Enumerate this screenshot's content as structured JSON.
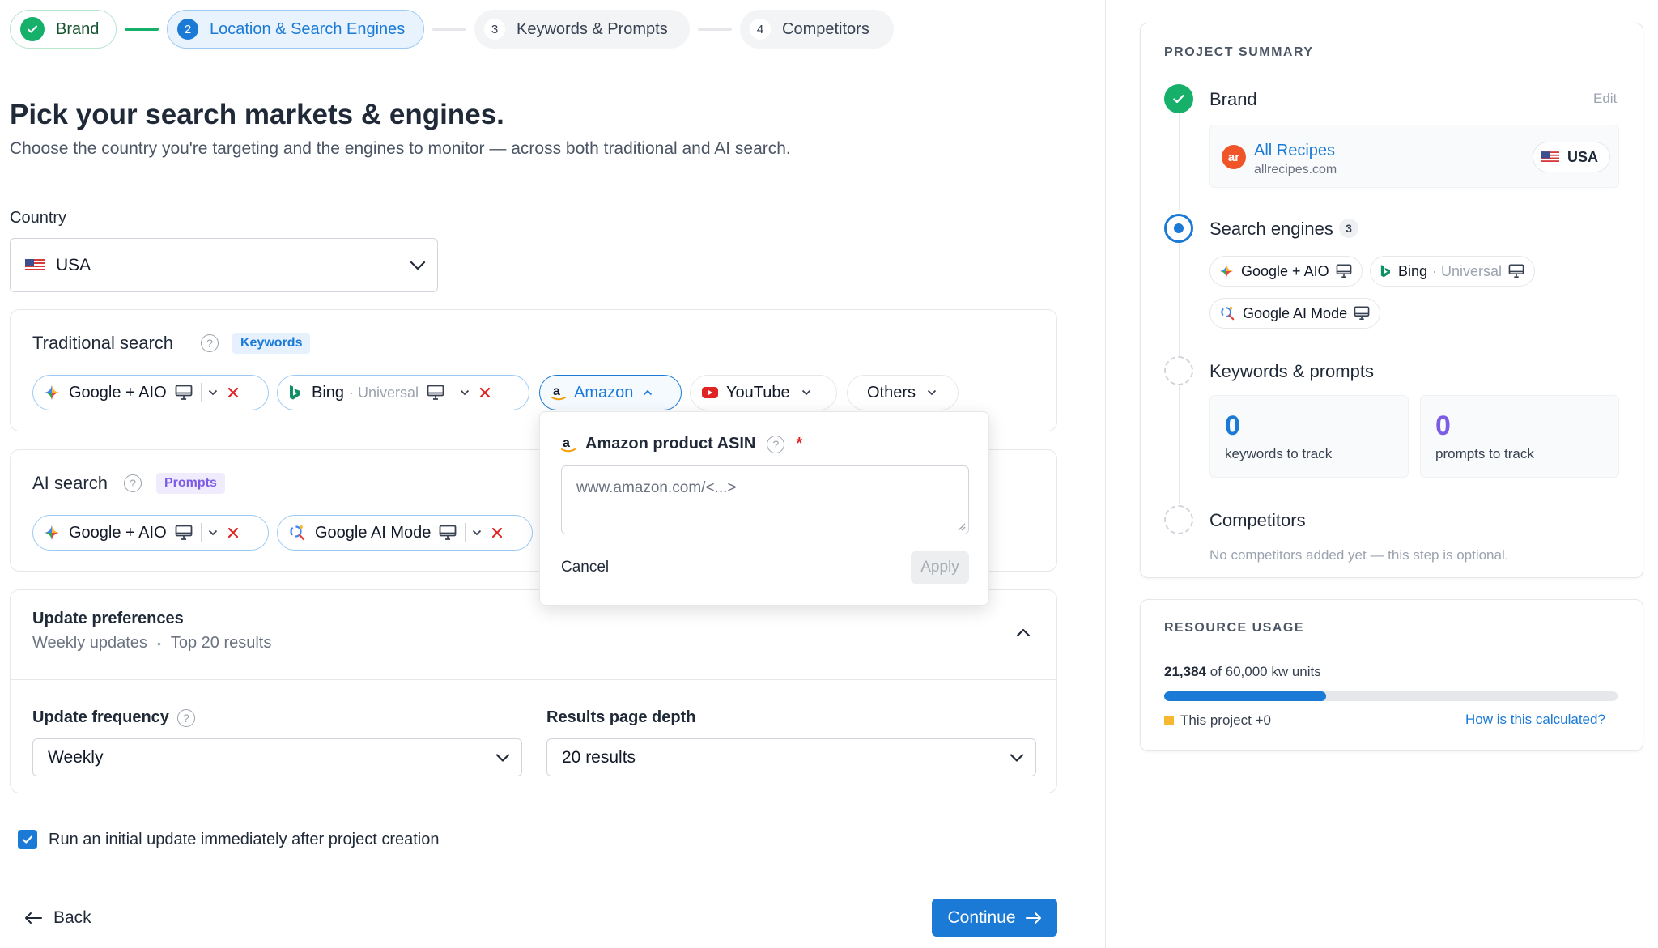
{
  "stepper": [
    {
      "num": "",
      "label": "Brand",
      "state": "done"
    },
    {
      "num": "2",
      "label": "Location & Search Engines",
      "state": "active"
    },
    {
      "num": "3",
      "label": "Keywords & Prompts",
      "state": "todo"
    },
    {
      "num": "4",
      "label": "Competitors",
      "state": "todo"
    }
  ],
  "page": {
    "title": "Pick your search markets & engines.",
    "subtitle": "Choose the country you're targeting and the engines to monitor — across both traditional and AI search."
  },
  "country": {
    "label": "Country",
    "value": "USA"
  },
  "traditional": {
    "title": "Traditional search",
    "tag": "Keywords",
    "chips": [
      {
        "label": "Google + AIO",
        "sub": ""
      },
      {
        "label": "Bing",
        "sub": "· Universal"
      },
      {
        "label": "Amazon"
      },
      {
        "label": "YouTube"
      },
      {
        "label": "Others"
      }
    ]
  },
  "ai": {
    "title": "AI search",
    "tag": "Prompts",
    "chips": [
      {
        "label": "Google + AIO"
      },
      {
        "label": "Google AI Mode"
      }
    ]
  },
  "popup": {
    "title": "Amazon product ASIN",
    "required": "*",
    "placeholder": "www.amazon.com/<...>",
    "cancel": "Cancel",
    "apply": "Apply"
  },
  "preferences": {
    "title": "Update preferences",
    "summary_freq": "Weekly updates",
    "summary_dot": "•",
    "summary_depth": "Top 20 results",
    "freq_label": "Update frequency",
    "freq_value": "Weekly",
    "depth_label": "Results page depth",
    "depth_value": "20 results"
  },
  "initial_update": {
    "label": "Run an initial update immediately after project creation",
    "checked": true
  },
  "nav": {
    "back": "Back",
    "continue": "Continue"
  },
  "summary": {
    "heading": "PROJECT SUMMARY",
    "brand_title": "Brand",
    "edit": "Edit",
    "brand_name": "All Recipes",
    "brand_domain": "allrecipes.com",
    "brand_logo": "ar",
    "brand_country": "USA",
    "engines_title": "Search engines",
    "engines_count": "3",
    "engines": [
      {
        "label": "Google + AIO",
        "sub": ""
      },
      {
        "label": "Bing",
        "sub": "· Universal"
      },
      {
        "label": "Google AI Mode",
        "sub": ""
      }
    ],
    "kp_title": "Keywords & prompts",
    "keywords_count": "0",
    "keywords_label": "keywords to track",
    "prompts_count": "0",
    "prompts_label": "prompts to track",
    "competitors_title": "Competitors",
    "competitors_note": "No competitors added yet — this step is optional."
  },
  "usage": {
    "heading": "RESOURCE USAGE",
    "used": "21,384",
    "total_text": "of 60,000 kw units",
    "used_fraction": 0.3564,
    "project_label": "This project +0",
    "how_link": "How is this calculated?"
  },
  "colors": {
    "accent": "#1a7ad6",
    "success": "#16b06a",
    "danger": "#e02424",
    "keywords_tag": "#1a7ad6",
    "prompts_tag": "#7c5ce6",
    "project_swatch": "#f5b82e"
  }
}
